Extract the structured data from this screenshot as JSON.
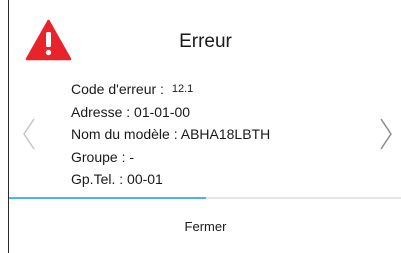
{
  "dialog": {
    "title": "Erreur",
    "icon": "warning-icon",
    "rows": [
      {
        "label": "Code d'erreur : ",
        "value": "12.1"
      },
      {
        "label": "Adresse : ",
        "value": "01-01-00"
      },
      {
        "label": "Nom du modèle : ",
        "value": "ABHA18LBTH"
      },
      {
        "label": "Groupe : ",
        "value": "-"
      },
      {
        "label": "Gp.Tel. : ",
        "value": "00-01"
      }
    ],
    "progress": 0.5,
    "close_label": "Fermer"
  },
  "colors": {
    "warning_red": "#e8232a",
    "progress_blue": "#49b6ea",
    "arrow_gray": "#9a9a9a"
  }
}
